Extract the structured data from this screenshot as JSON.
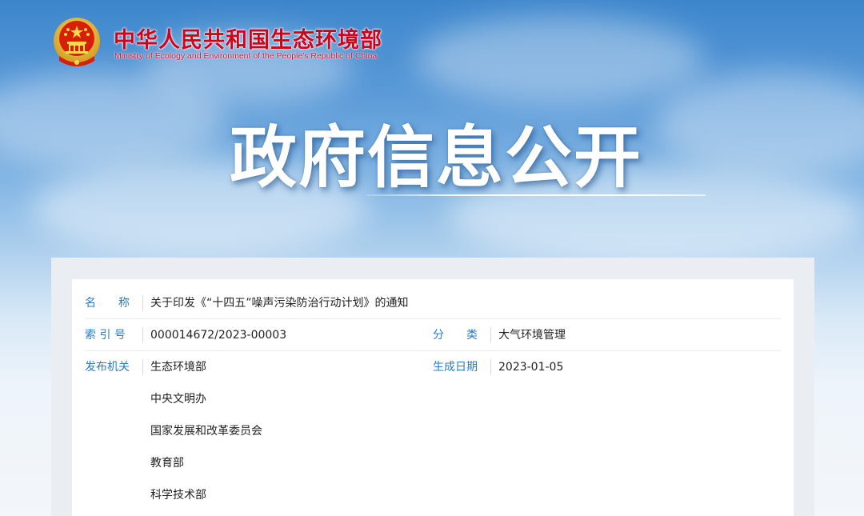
{
  "header": {
    "site_name": "中华人民共和国生态环境部",
    "site_name_en": "Ministry of Ecology and Environment of the People's Republic of China",
    "emblem_icon": "national-emblem-icon"
  },
  "banner": {
    "title": "政府信息公开"
  },
  "colors": {
    "brand_red": "#d0021b",
    "label_blue": "#2a7bc8",
    "text": "#222222"
  },
  "document": {
    "name_label": "名　　称",
    "name_value": "关于印发《“十四五”噪声污染防治行动计划》的通知",
    "index_label": "索 引 号",
    "index_value": "000014672/2023-00003",
    "category_label": "分　　类",
    "category_value": "大气环境管理",
    "publisher_label": "发布机关",
    "publishers": [
      "生态环境部",
      "中央文明办",
      "国家发展和改革委员会",
      "教育部",
      "科学技术部"
    ],
    "date_label": "生成日期",
    "date_value": "2023-01-05"
  }
}
